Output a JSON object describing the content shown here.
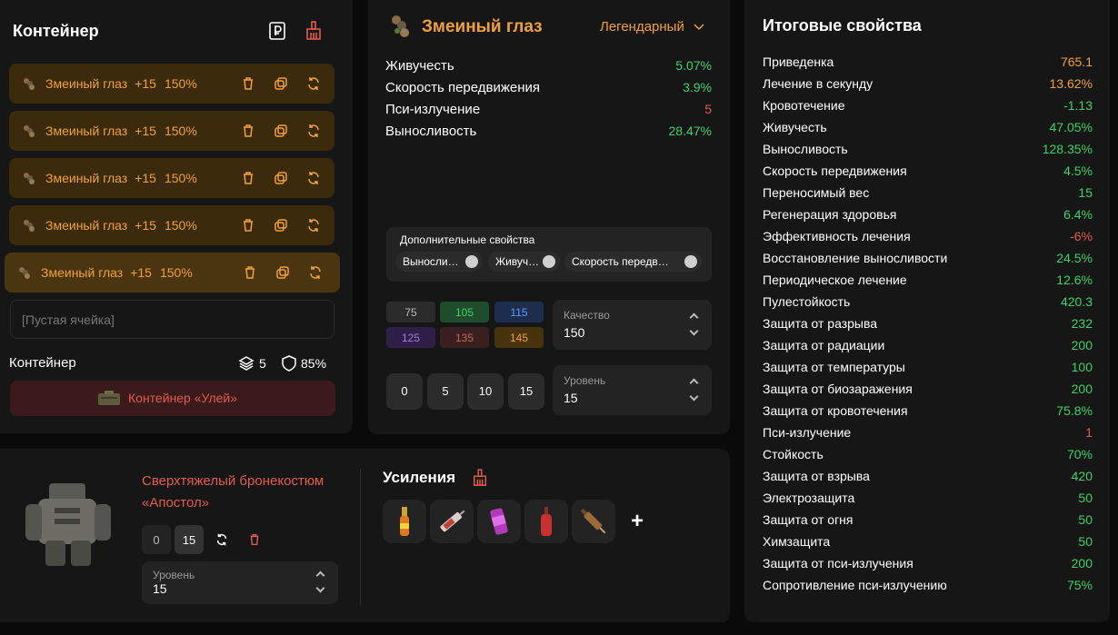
{
  "container": {
    "title": "Контейнер",
    "items": [
      {
        "name": "Змеиный глаз",
        "level": "+15",
        "pct": "150%"
      },
      {
        "name": "Змеиный глаз",
        "level": "+15",
        "pct": "150%"
      },
      {
        "name": "Змеиный глаз",
        "level": "+15",
        "pct": "150%"
      },
      {
        "name": "Змеиный глаз",
        "level": "+15",
        "pct": "150%"
      },
      {
        "name": "Змеиный глаз",
        "level": "+15",
        "pct": "150%"
      }
    ],
    "empty_cell": "[Пустая ячейка]",
    "footer_label": "Контейнер",
    "slots_count": "5",
    "protection_pct": "85%",
    "container_button": "Контейнер «Улей»"
  },
  "artifact": {
    "name": "Змеиный глаз",
    "rarity": "Легендарный",
    "stats": [
      {
        "label": "Живучесть",
        "value": "5.07%",
        "color": "green"
      },
      {
        "label": "Скорость передвижения",
        "value": "3.9%",
        "color": "green"
      },
      {
        "label": "Пси-излучение",
        "value": "5",
        "color": "red"
      },
      {
        "label": "Выносливость",
        "value": "28.47%",
        "color": "green"
      }
    ],
    "extra_title": "Дополнительные свойства",
    "extra_chips": [
      "Выносли…",
      "Живуч…",
      "Скорость передв…"
    ],
    "quality_tiles": [
      "75",
      "105",
      "115",
      "125",
      "135",
      "145"
    ],
    "quality_label": "Качество",
    "quality_value": "150",
    "level_buttons": [
      "0",
      "5",
      "10",
      "15"
    ],
    "level_label": "Уровень",
    "level_value": "15"
  },
  "armor": {
    "name_line1": "Сверхтяжелый бронекостюм",
    "name_line2": "«Апостол»",
    "btn_0": "0",
    "btn_15": "15",
    "level_label": "Уровень",
    "level_value": "15"
  },
  "boosts": {
    "title": "Усиления",
    "add": "+"
  },
  "totals": {
    "title": "Итоговые свойства",
    "rows": [
      {
        "label": "Приведенка",
        "value": "765.1",
        "color": "orange"
      },
      {
        "label": "Лечение в секунду",
        "value": "13.62%",
        "color": "orange"
      },
      {
        "label": "Кровотечение",
        "value": "-1.13",
        "color": "green"
      },
      {
        "label": "Живучесть",
        "value": "47.05%",
        "color": "green"
      },
      {
        "label": "Выносливость",
        "value": "128.35%",
        "color": "green"
      },
      {
        "label": "Скорость передвижения",
        "value": "4.5%",
        "color": "green"
      },
      {
        "label": "Переносимый вес",
        "value": "15",
        "color": "green"
      },
      {
        "label": "Регенерация здоровья",
        "value": "6.4%",
        "color": "green"
      },
      {
        "label": "Эффективность лечения",
        "value": "-6%",
        "color": "red"
      },
      {
        "label": "Восстановление выносливости",
        "value": "24.5%",
        "color": "green"
      },
      {
        "label": "Периодическое лечение",
        "value": "12.6%",
        "color": "green"
      },
      {
        "label": "Пулестойкость",
        "value": "420.3",
        "color": "green"
      },
      {
        "label": "Защита от разрыва",
        "value": "232",
        "color": "green"
      },
      {
        "label": "Защита от радиации",
        "value": "200",
        "color": "green"
      },
      {
        "label": "Защита от температуры",
        "value": "100",
        "color": "green"
      },
      {
        "label": "Защита от биозаражения",
        "value": "200",
        "color": "green"
      },
      {
        "label": "Защита от кровотечения",
        "value": "75.8%",
        "color": "green"
      },
      {
        "label": "Пси-излучение",
        "value": "1",
        "color": "red"
      },
      {
        "label": "Стойкость",
        "value": "70%",
        "color": "green"
      },
      {
        "label": "Защита от взрыва",
        "value": "420",
        "color": "green"
      },
      {
        "label": "Электрозащита",
        "value": "50",
        "color": "green"
      },
      {
        "label": "Защита от огня",
        "value": "50",
        "color": "green"
      },
      {
        "label": "Химзащита",
        "value": "50",
        "color": "green"
      },
      {
        "label": "Защита от пси-излучения",
        "value": "200",
        "color": "green"
      },
      {
        "label": "Сопротивление пси-излучению",
        "value": "75%",
        "color": "green"
      }
    ]
  },
  "colors": {
    "accent": "#f0a13c",
    "green": "#3dd26a",
    "red": "#e35b4f",
    "panel": "#161616"
  }
}
